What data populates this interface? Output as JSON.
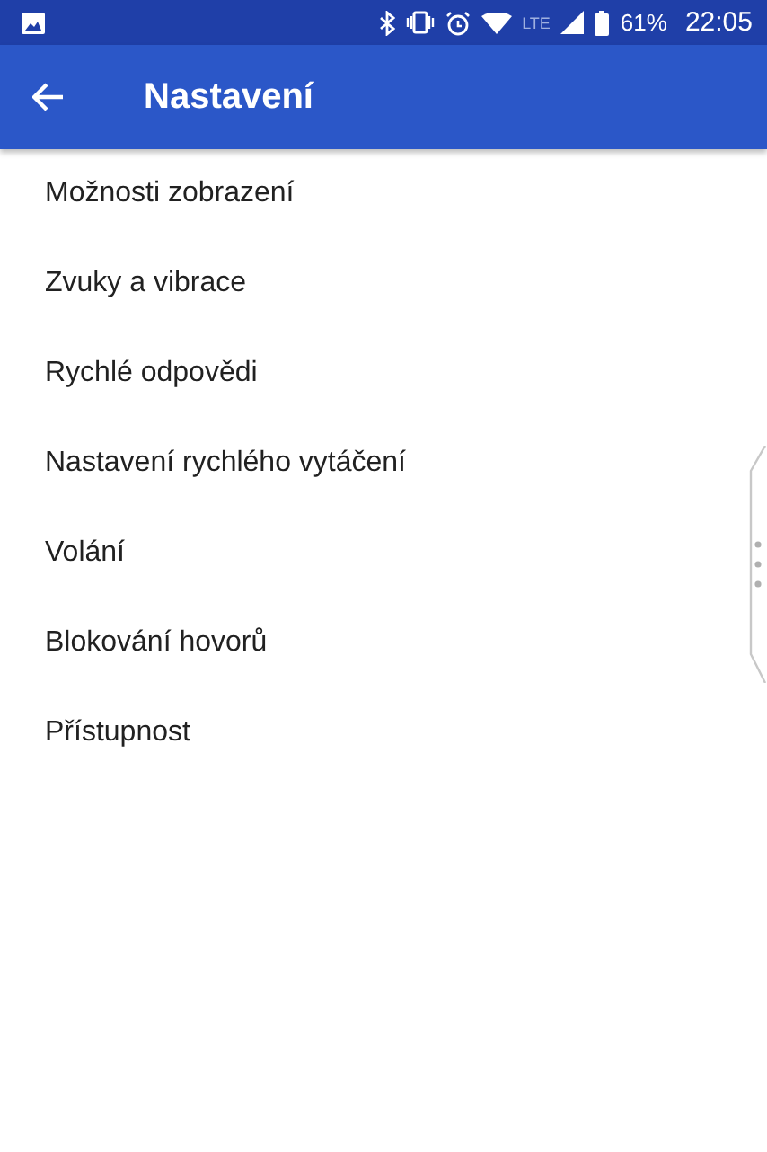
{
  "status_bar": {
    "network": "LTE",
    "battery": "61%",
    "time": "22:05"
  },
  "app_bar": {
    "title": "Nastavení"
  },
  "items": [
    {
      "label": "Možnosti zobrazení"
    },
    {
      "label": "Zvuky a vibrace"
    },
    {
      "label": "Rychlé odpovědi"
    },
    {
      "label": "Nastavení rychlého vytáčení"
    },
    {
      "label": "Volání"
    },
    {
      "label": "Blokování hovorů"
    },
    {
      "label": "Přístupnost"
    }
  ]
}
